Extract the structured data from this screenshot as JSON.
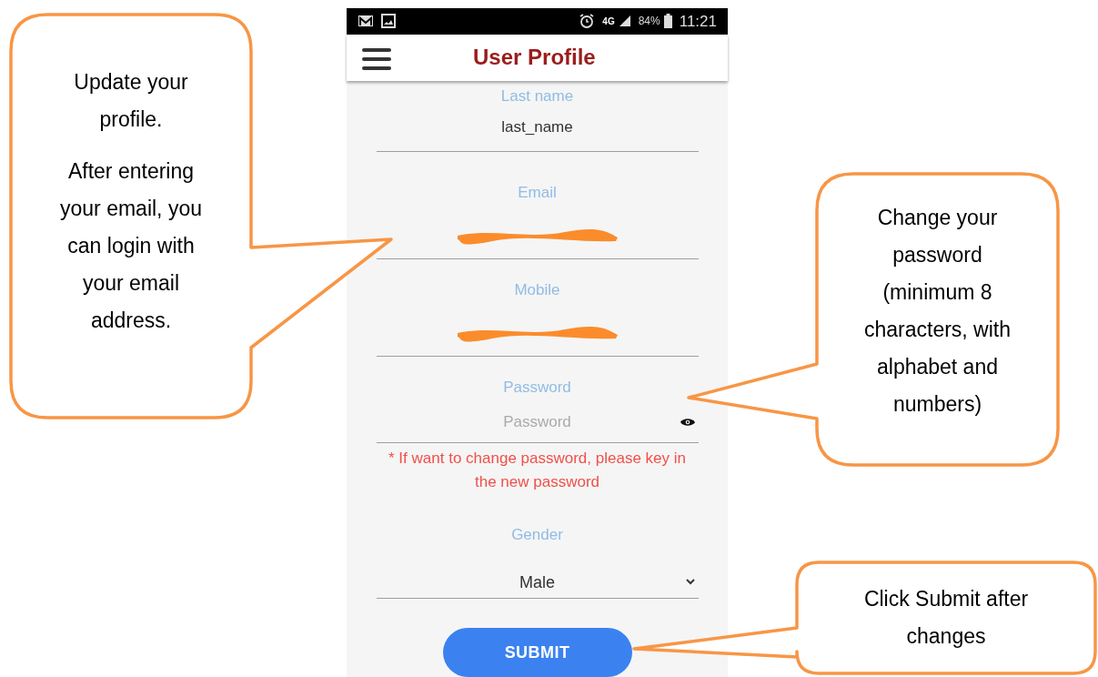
{
  "status_bar": {
    "battery": "84%",
    "network": "4G",
    "time": "11:21"
  },
  "app_bar": {
    "title": "User Profile"
  },
  "fields": [
    {
      "kind": "text",
      "label": "Last name",
      "value": "last_name"
    },
    {
      "kind": "redacted",
      "label": "Email"
    },
    {
      "kind": "redacted",
      "label": "Mobile"
    },
    {
      "kind": "password",
      "label": "Password",
      "placeholder": "Password",
      "hint": "* If want to change password, please key in the new password"
    },
    {
      "kind": "select",
      "label": "Gender",
      "value": "Male"
    }
  ],
  "submit_button": "SUBMIT",
  "callouts": [
    {
      "paragraphs": [
        "Update your profile.",
        "After entering your email, you can login with your email address."
      ]
    },
    {
      "paragraphs": [
        "Change your password (minimum 8 characters, with alphabet and numbers)"
      ]
    },
    {
      "paragraphs": [
        "Click Submit after changes"
      ]
    }
  ]
}
